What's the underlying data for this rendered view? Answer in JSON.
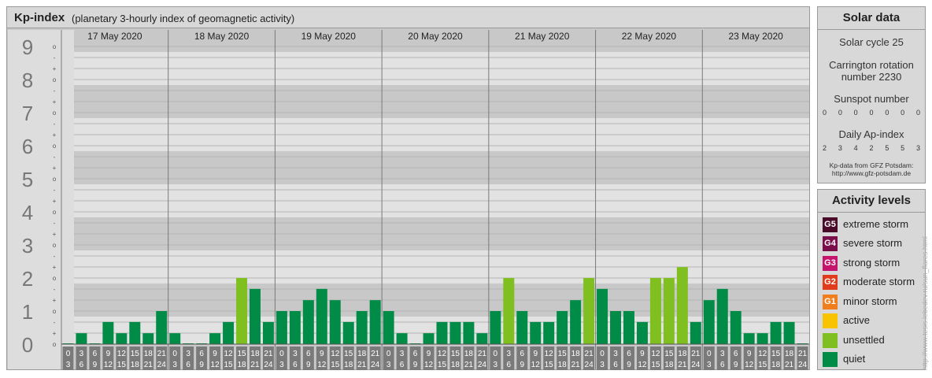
{
  "title": {
    "main": "Kp-index",
    "subtitle": "(planetary 3-hourly index of geomagnetic activity)"
  },
  "chart_data": {
    "type": "bar",
    "title": "Kp-index",
    "subtitle": "(planetary 3-hourly index of geomagnetic activity)",
    "ylim": [
      0,
      9.33
    ],
    "y_ticks": [
      "0",
      "1",
      "2",
      "3",
      "4",
      "5",
      "6",
      "7",
      "8",
      "9"
    ],
    "y_subticks": [
      "-",
      "o",
      "+"
    ],
    "days": [
      "17 May 2020",
      "18 May 2020",
      "19 May 2020",
      "20 May 2020",
      "21 May 2020",
      "22 May 2020",
      "23 May 2020"
    ],
    "interval_start_hours": [
      "0",
      "3",
      "6",
      "9",
      "12",
      "15",
      "18",
      "21"
    ],
    "interval_end_hours": [
      "3",
      "6",
      "9",
      "12",
      "15",
      "18",
      "21",
      "24"
    ],
    "values": [
      [
        0,
        0.33,
        0,
        0.67,
        0.33,
        0.67,
        0.33,
        1
      ],
      [
        0.33,
        0,
        0,
        0.33,
        0.67,
        2,
        1.67,
        0.67
      ],
      [
        1,
        1,
        1.33,
        1.67,
        1.33,
        0.67,
        1,
        1.33
      ],
      [
        1,
        0.33,
        0,
        0.33,
        0.67,
        0.67,
        0.67,
        0.33
      ],
      [
        1,
        2,
        1,
        0.67,
        0.67,
        1,
        1.33,
        2
      ],
      [
        1.67,
        1,
        1,
        0.67,
        2,
        2,
        2.33,
        0.67
      ],
      [
        1.33,
        1.67,
        1,
        0.33,
        0.33,
        0.67,
        0.67,
        0
      ]
    ],
    "legend_placement": "right",
    "colors": {
      "quiet": "#008c46",
      "unsettled": "#7fbf1f",
      "frame": "#c8c8c8",
      "band_light": "#e2e2e2",
      "band_dark": "#c8c8c8",
      "left_axis_bg": "#dddddd",
      "hour_box": "#7a7a7a"
    }
  },
  "solar": {
    "title": "Solar data",
    "solar_cycle": "Solar cycle 25",
    "carrington_line1": "Carrington rotation",
    "carrington_line2": "number 2230",
    "sunspot_title": "Sunspot number",
    "sunspot_values": [
      "0",
      "0",
      "0",
      "0",
      "0",
      "0",
      "0"
    ],
    "ap_title": "Daily Ap-index",
    "ap_values": [
      "2",
      "3",
      "4",
      "2",
      "5",
      "5",
      "3"
    ],
    "credit_line1": "Kp-data from GFZ Potsdam:",
    "credit_line2": "http://www.gfz-potsdam.de"
  },
  "activity": {
    "title": "Activity levels",
    "levels": [
      {
        "badge": "G5",
        "label": "extreme storm",
        "color": "#4a0a2a"
      },
      {
        "badge": "G4",
        "label": "severe storm",
        "color": "#7a0e4a"
      },
      {
        "badge": "G3",
        "label": "strong storm",
        "color": "#c4146e"
      },
      {
        "badge": "G2",
        "label": "moderate storm",
        "color": "#e03c1c"
      },
      {
        "badge": "G1",
        "label": "minor storm",
        "color": "#f07e1c"
      },
      {
        "badge": "",
        "label": "active",
        "color": "#f8c400"
      },
      {
        "badge": "",
        "label": "unsettled",
        "color": "#7fbf1f"
      },
      {
        "badge": "",
        "label": "quiet",
        "color": "#008c46"
      }
    ]
  },
  "watermark": "http://www.tesis.lebedev.ru/sun_flares.html"
}
